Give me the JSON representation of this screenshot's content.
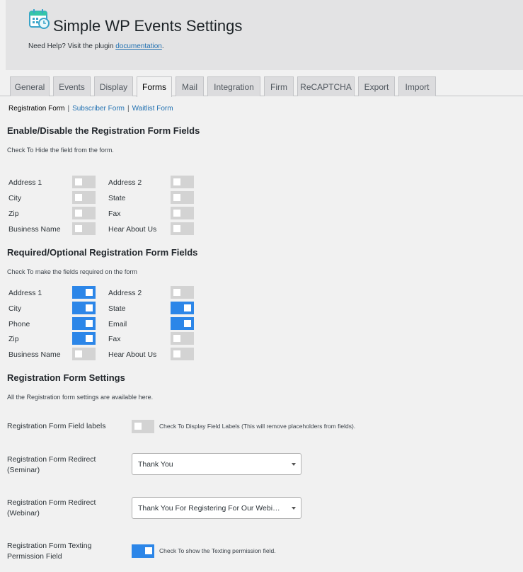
{
  "header": {
    "title": "Simple WP Events Settings",
    "help_prefix": "Need Help? Visit the plugin ",
    "help_link": "documentation",
    "help_suffix": ".",
    "logo_icon": "calendar-clock-icon"
  },
  "tabs": [
    "General",
    "Events",
    "Display",
    "Forms",
    "Mail",
    "Integration",
    "Firm",
    "ReCAPTCHA",
    "Export",
    "Import"
  ],
  "active_tab": "Forms",
  "subnav": {
    "current": "Registration Form",
    "links": [
      "Subscriber Form",
      "Waitlist Form"
    ],
    "separator": "|"
  },
  "section_hide": {
    "title": "Enable/Disable the Registration Form Fields",
    "desc": "Check To Hide the field from the form.",
    "fields": [
      {
        "label": "Address 1",
        "on": false
      },
      {
        "label": "Address 2",
        "on": false
      },
      {
        "label": "City",
        "on": false
      },
      {
        "label": "State",
        "on": false
      },
      {
        "label": "Zip",
        "on": false
      },
      {
        "label": "Fax",
        "on": false
      },
      {
        "label": "Business Name",
        "on": false
      },
      {
        "label": "Hear About Us",
        "on": false
      }
    ]
  },
  "section_required": {
    "title": "Required/Optional Registration Form Fields",
    "desc": "Check To make the fields required on the form",
    "fields": [
      {
        "label": "Address 1",
        "on": true
      },
      {
        "label": "Address 2",
        "on": false
      },
      {
        "label": "City",
        "on": true
      },
      {
        "label": "State",
        "on": true
      },
      {
        "label": "Phone",
        "on": true
      },
      {
        "label": "Email",
        "on": true
      },
      {
        "label": "Zip",
        "on": true
      },
      {
        "label": "Fax",
        "on": false
      },
      {
        "label": "Business Name",
        "on": false
      },
      {
        "label": "Hear About Us",
        "on": false
      }
    ]
  },
  "section_settings": {
    "title": "Registration Form Settings",
    "desc": "All the Registration form settings are available here.",
    "field_labels": {
      "label": "Registration Form Field labels",
      "on": false,
      "hint": "Check To Display Field Labels (This will remove placeholders from fields)."
    },
    "redirect_seminar": {
      "label_line1": "Registration Form Redirect",
      "label_line2": "(Seminar)",
      "value": "Thank You"
    },
    "redirect_webinar": {
      "label_line1": "Registration Form Redirect",
      "label_line2": "(Webinar)",
      "value": "Thank You For Registering For Our Webinar"
    },
    "texting": {
      "label_line1": "Registration Form Texting",
      "label_line2": "Permission Field",
      "on": true,
      "hint": "Check To show the Texting permission field."
    }
  },
  "colors": {
    "toggle_on": "#2c86e8",
    "toggle_off": "#d3d3d3",
    "link": "#2271b1"
  }
}
